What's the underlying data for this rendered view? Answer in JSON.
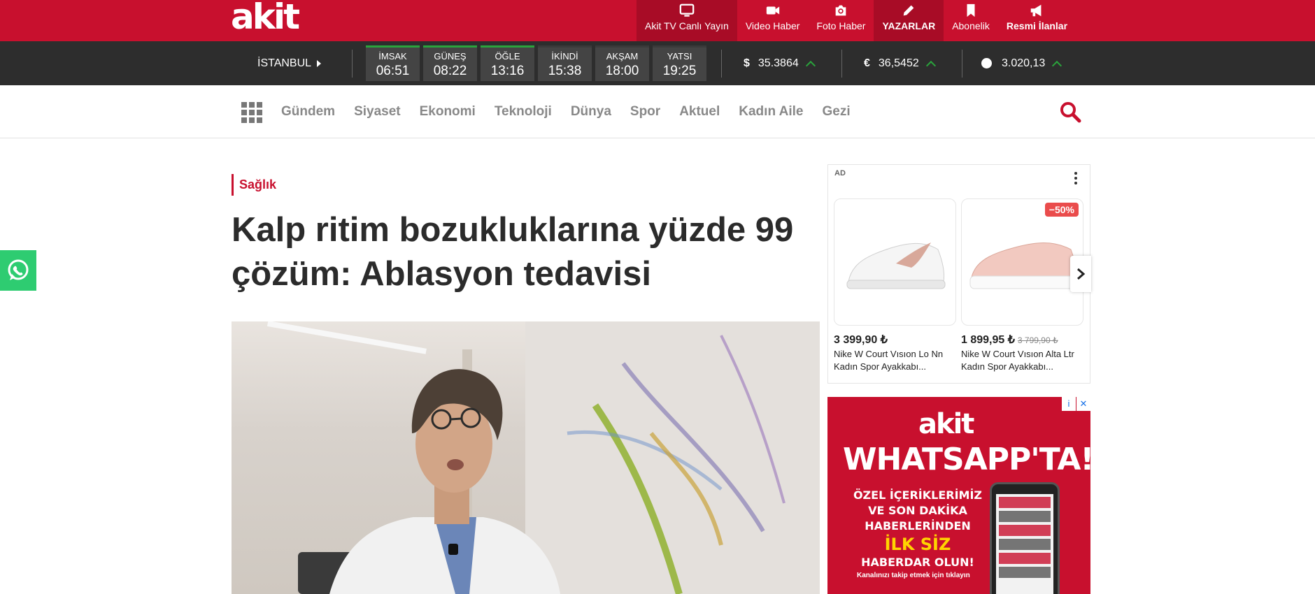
{
  "header": {
    "logo": "akit",
    "nav": [
      {
        "label": "Akit TV Canlı Yayın",
        "icon": "tv-icon"
      },
      {
        "label": "Video Haber",
        "icon": "video-camera-icon"
      },
      {
        "label": "Foto Haber",
        "icon": "photo-camera-icon"
      },
      {
        "label": "YAZARLAR",
        "icon": "pencil-icon"
      },
      {
        "label": "Abonelik",
        "icon": "bookmark-icon"
      },
      {
        "label": "Resmi İlanlar",
        "icon": "megaphone-icon"
      }
    ]
  },
  "infobar": {
    "city": "İSTANBUL",
    "prayers": [
      {
        "name": "İMSAK",
        "time": "06:51"
      },
      {
        "name": "GÜNEŞ",
        "time": "08:22"
      },
      {
        "name": "ÖĞLE",
        "time": "13:16"
      },
      {
        "name": "İKİNDİ",
        "time": "15:38"
      },
      {
        "name": "AKŞAM",
        "time": "18:00"
      },
      {
        "name": "YATSI",
        "time": "19:25"
      }
    ],
    "currencies": [
      {
        "symbol": "$",
        "value": "35.3864",
        "trend": "up"
      },
      {
        "symbol": "€",
        "value": "36,5452",
        "trend": "up"
      },
      {
        "symbol": "gold",
        "value": "3.020,13",
        "trend": "up"
      }
    ]
  },
  "categories": [
    "Gündem",
    "Siyaset",
    "Ekonomi",
    "Teknoloji",
    "Dünya",
    "Spor",
    "Aktuel",
    "Kadın Aile",
    "Gezi"
  ],
  "article": {
    "category": "Sağlık",
    "headline_line1": "Kalp ritim bozukluklarına yüzde 99",
    "headline_line2": "çözüm: Ablasyon tedavisi"
  },
  "ad": {
    "label": "AD",
    "products": [
      {
        "price": "3 399,90 ₺",
        "old_price": "",
        "name": "Nike W Court Vısıon Lo Nn Kadın Spor Ayakkabı...",
        "discount": ""
      },
      {
        "price": "1 899,95 ₺",
        "old_price": "3 799,90 ₺",
        "name": "Nike W Court Vısıon Alta Ltr Kadın Spor Ayakkabı...",
        "discount": "−50%"
      }
    ]
  },
  "promo": {
    "logo": "akit",
    "title": "WHATSAPP'TA!",
    "line1": "ÖZEL İÇERİKLERİMİZ",
    "line2": "VE SON DAKİKA",
    "line3": "HABERLERİNDEN",
    "highlight": "İLK SİZ",
    "line4": "HABERDAR OLUN!",
    "small": "Kanalınızı takip etmek için tıklayın",
    "info": "i",
    "close": "✕"
  },
  "colors": {
    "brand_red": "#c8102e",
    "dark_bar": "#2d2d2d",
    "whatsapp_green": "#2ecc71",
    "trend_green": "#2aa33c"
  }
}
